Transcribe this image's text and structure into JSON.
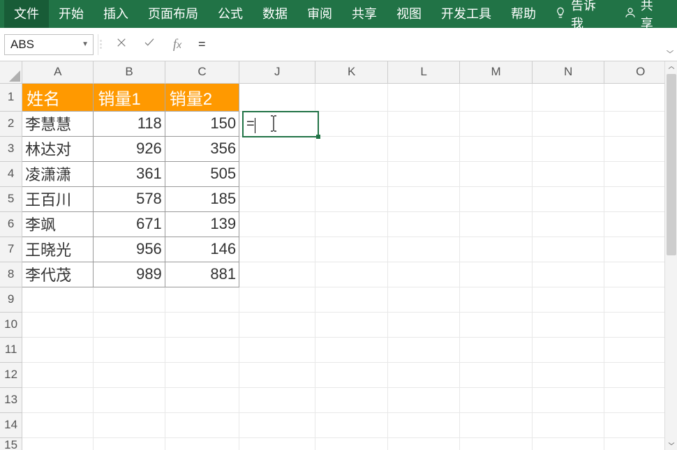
{
  "ribbon": {
    "file": "文件",
    "home": "开始",
    "insert": "插入",
    "layout": "页面布局",
    "formulas": "公式",
    "data": "数据",
    "review": "审阅",
    "share_tab": "共享",
    "view": "视图",
    "dev": "开发工具",
    "help": "帮助",
    "tellme": "告诉我",
    "share": "共享"
  },
  "formula_bar": {
    "namebox": "ABS",
    "formula": "="
  },
  "columns": [
    "A",
    "B",
    "C",
    "J",
    "K",
    "L",
    "M",
    "N",
    "O"
  ],
  "row_numbers": [
    "1",
    "2",
    "3",
    "4",
    "5",
    "6",
    "7",
    "8",
    "9",
    "10",
    "11",
    "12",
    "13",
    "14",
    "15"
  ],
  "headers": {
    "A": "姓名",
    "B": "销量1",
    "C": "销量2"
  },
  "rows": [
    {
      "A": "李慧慧",
      "B": "118",
      "C": "150"
    },
    {
      "A": "林达对",
      "B": "926",
      "C": "356"
    },
    {
      "A": "凌潇潇",
      "B": "361",
      "C": "505"
    },
    {
      "A": "王百川",
      "B": "578",
      "C": "185"
    },
    {
      "A": "李飒",
      "B": "671",
      "C": "139"
    },
    {
      "A": "王晓光",
      "B": "956",
      "C": "146"
    },
    {
      "A": "李代茂",
      "B": "989",
      "C": "881"
    }
  ],
  "active_cell": {
    "value": "="
  }
}
